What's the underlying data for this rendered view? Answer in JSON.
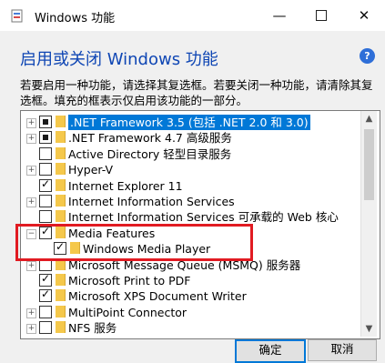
{
  "window": {
    "title": "Windows 功能"
  },
  "header": {
    "heading": "启用或关闭 Windows 功能"
  },
  "description": "若要启用一种功能，请选择其复选框。若要关闭一种功能，请清除其复选框。填充的框表示仅启用该功能的一部分。",
  "features": [
    {
      "label": ".NET Framework 3.5 (包括 .NET 2.0 和 3.0)",
      "state": "partial",
      "expander": "+",
      "selected": true
    },
    {
      "label": ".NET Framework 4.7 高级服务",
      "state": "partial",
      "expander": "+"
    },
    {
      "label": "Active Directory 轻型目录服务",
      "state": "unchecked",
      "expander": ""
    },
    {
      "label": "Hyper-V",
      "state": "unchecked",
      "expander": "+"
    },
    {
      "label": "Internet Explorer 11",
      "state": "checked",
      "expander": ""
    },
    {
      "label": "Internet Information Services",
      "state": "unchecked",
      "expander": "+"
    },
    {
      "label": "Internet Information Services 可承载的 Web 核心",
      "state": "unchecked",
      "expander": ""
    },
    {
      "label": "Media Features",
      "state": "checked",
      "expander": "−"
    },
    {
      "label": "Windows Media Player",
      "state": "checked",
      "expander": "",
      "indent": 1
    },
    {
      "label": "Microsoft Message Queue (MSMQ) 服务器",
      "state": "unchecked",
      "expander": "+"
    },
    {
      "label": "Microsoft Print to PDF",
      "state": "checked",
      "expander": ""
    },
    {
      "label": "Microsoft XPS Document Writer",
      "state": "checked",
      "expander": ""
    },
    {
      "label": "MultiPoint Connector",
      "state": "unchecked",
      "expander": "+"
    },
    {
      "label": "NFS 服务",
      "state": "unchecked",
      "expander": "+"
    }
  ],
  "buttons": {
    "ok": "确定",
    "cancel": "取消"
  },
  "icons": {
    "help": "?",
    "minimize": "—",
    "close": "✕",
    "scroll_up": "▲",
    "scroll_down": "▼"
  },
  "colors": {
    "heading": "#0f46b4",
    "selection": "#0078d7",
    "highlight_box": "#e11b22"
  }
}
